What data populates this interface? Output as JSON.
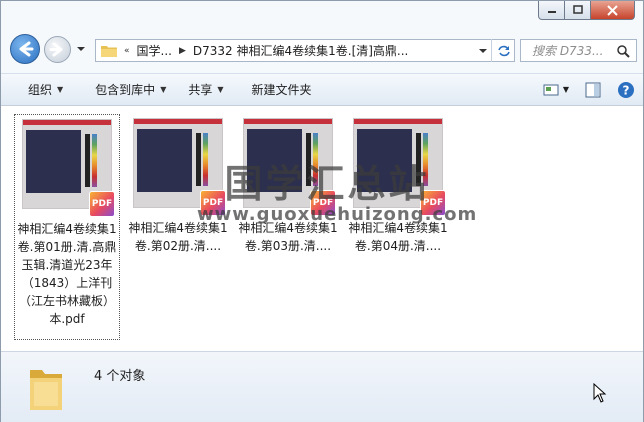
{
  "window": {
    "caption_buttons": [
      "minimize-icon",
      "maximize-icon",
      "close-icon"
    ]
  },
  "address_bar": {
    "overflow_chevron": "«",
    "crumbs": [
      "国学...",
      "D7332 神相汇编4卷续集1卷.[清]高鼎..."
    ],
    "search_placeholder": "搜索 D733..."
  },
  "toolbar": {
    "organize": "组织",
    "include_in_library": "包含到库中",
    "share": "共享",
    "new_folder": "新建文件夹"
  },
  "files": [
    {
      "name": "神相汇编4卷续集1卷.第01册.清.高鼎玉辑.清道光23年（1843）上洋刊（江左书林藏板）本.pdf",
      "selected": true
    },
    {
      "name": "神相汇编4卷续集1卷.第02册.清....",
      "selected": false
    },
    {
      "name": "神相汇编4卷续集1卷.第03册.清....",
      "selected": false
    },
    {
      "name": "神相汇编4卷续集1卷.第04册.清....",
      "selected": false
    }
  ],
  "thumbnail": {
    "pdf_badge": "PDF",
    "icon_label": "PDF"
  },
  "watermark": {
    "title": "国学汇总站",
    "url": "www.guoxuehuizong.com"
  },
  "details": {
    "count": "4 个对象"
  },
  "colors": {
    "accent": "#2a6fc0",
    "toolbar_bg": "#e1eaf4",
    "close_button": "#c7442c",
    "thumb_red": "#c6303a"
  }
}
